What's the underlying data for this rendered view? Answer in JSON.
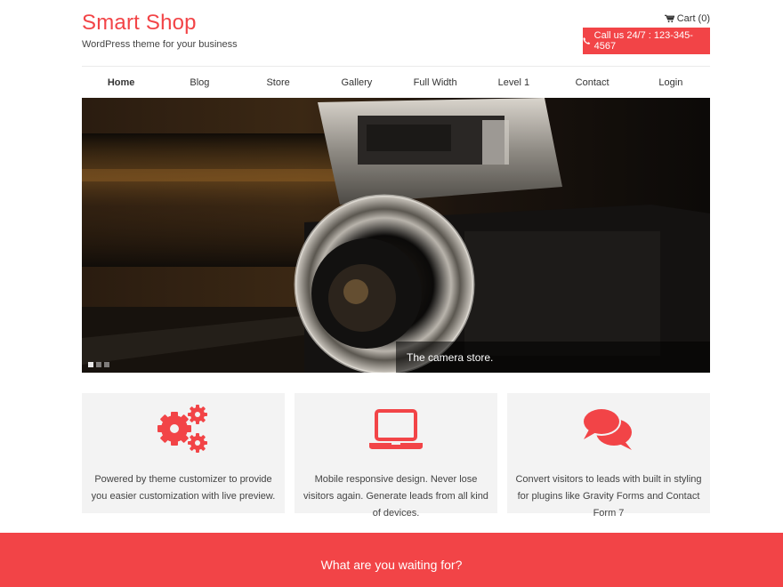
{
  "header": {
    "site_title": "Smart Shop",
    "tagline": "WordPress theme for your business",
    "cart_label": "Cart (0)",
    "call_label": "Call us 24/7 : 123-345-4567",
    "accent_color": "#f24447"
  },
  "nav": {
    "items": [
      {
        "label": "Home",
        "active": true
      },
      {
        "label": "Blog"
      },
      {
        "label": "Store"
      },
      {
        "label": "Gallery"
      },
      {
        "label": "Full Width"
      },
      {
        "label": "Level 1"
      },
      {
        "label": "Contact"
      },
      {
        "label": "Login"
      }
    ]
  },
  "slider": {
    "caption": "The camera store.",
    "slide_count": 3,
    "active_slide": 1
  },
  "features": [
    {
      "icon": "gears-icon",
      "text": "Powered by theme customizer to provide you easier customization with live preview."
    },
    {
      "icon": "laptop-icon",
      "text": "Mobile responsive design. Never lose visitors again. Generate leads from all kind of devices."
    },
    {
      "icon": "comments-icon",
      "text": "Convert visitors to leads with built in styling for plugins like Gravity Forms and Contact Form 7"
    }
  ],
  "cta": {
    "text": "What are you waiting for?"
  }
}
